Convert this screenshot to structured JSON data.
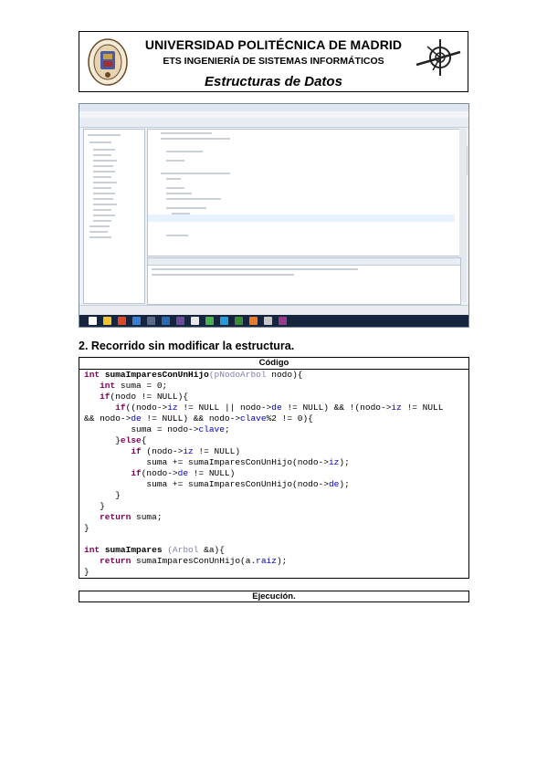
{
  "header": {
    "university": "UNIVERSIDAD POLITÉCNICA DE MADRID",
    "school": "ETS INGENIERÍA DE SISTEMAS INFORMÁTICOS",
    "course": "Estructuras de Datos",
    "seal_icon": "university-seal",
    "logo_icon": "school-logo"
  },
  "section": {
    "title": "2. Recorrido sin modificar la estructura."
  },
  "code_table": {
    "header": "Código",
    "lines": [
      {
        "k": "int",
        "f": "sumaImparesConUnHijo",
        "t": "(pNodoArbol",
        "r": " nodo){"
      },
      {
        "i": "   ",
        "k": "int",
        "r": " suma = 0;"
      },
      {
        "i": "   ",
        "k": "if",
        "r": "(nodo != NULL){"
      },
      {
        "i": "      ",
        "k": "if",
        "r": "((nodo->",
        "fld1": "iz",
        "r2": " != NULL || nodo->",
        "fld2": "de",
        "r3": " != NULL) && !(nodo->",
        "fld3": "iz",
        "r4": " != NULL"
      },
      {
        "r": "&& nodo->",
        "fld1": "de",
        "r2": " != NULL) && nodo->",
        "fld2": "clave",
        "r3": "%2 != 0){"
      },
      {
        "i": "         ",
        "r": "suma = nodo->",
        "fld1": "clave",
        "r2": ";"
      },
      {
        "i": "      ",
        "r": "}",
        "k2": "else",
        "r5": "{"
      },
      {
        "i": "         ",
        "k": "if",
        "r": " (nodo->",
        "fld1": "iz",
        "r2": " != NULL)"
      },
      {
        "i": "            ",
        "r": "suma += sumaImparesConUnHijo(nodo->",
        "fld1": "iz",
        "r2": ");"
      },
      {
        "i": "         ",
        "k": "if",
        "r": "(nodo->",
        "fld1": "de",
        "r2": " != NULL)"
      },
      {
        "i": "            ",
        "r": "suma += sumaImparesConUnHijo(nodo->",
        "fld1": "de",
        "r2": ");"
      },
      {
        "i": "      ",
        "r": "}"
      },
      {
        "i": "   ",
        "r": "}"
      },
      {
        "i": "   ",
        "k": "return",
        "r": " suma;"
      },
      {
        "r": "}"
      },
      {
        "r": ""
      },
      {
        "k": "int",
        "f": "sumaImpares",
        "t": " (Arbol",
        "r": " &a){"
      },
      {
        "i": "   ",
        "k": "return",
        "r": " sumaImparesConUnHijo(a.",
        "fld1": "raiz",
        "r2": ");"
      },
      {
        "r": "}"
      }
    ]
  },
  "execution": {
    "header": "Ejecución."
  },
  "ide_screenshot": {
    "description_icon": "ide-screenshot-image"
  }
}
